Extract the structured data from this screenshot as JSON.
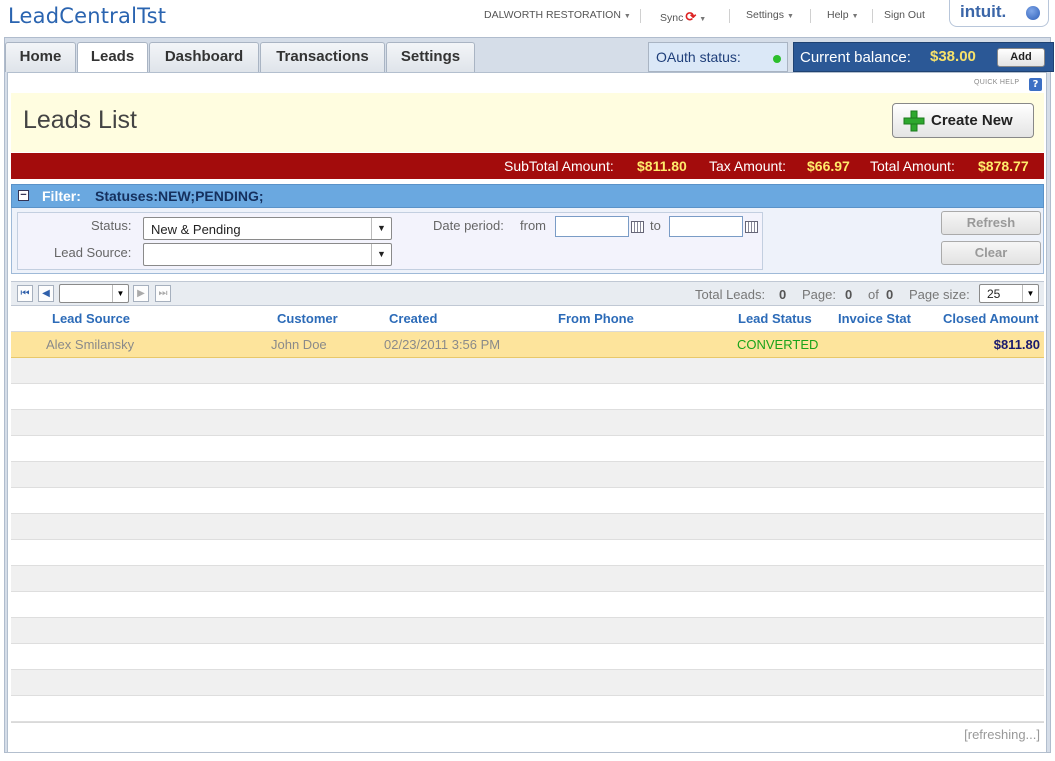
{
  "app": {
    "title": "LeadCentralTst"
  },
  "topnav": {
    "company": "DALWORTH RESTORATION",
    "sync": "Sync",
    "settings": "Settings",
    "help": "Help",
    "signout": "Sign Out",
    "logo_text": "intuit."
  },
  "tabs": [
    {
      "label": "Home"
    },
    {
      "label": "Leads",
      "active": true
    },
    {
      "label": "Dashboard"
    },
    {
      "label": "Transactions"
    },
    {
      "label": "Settings"
    }
  ],
  "oauth": {
    "label": "OAuth status:",
    "status_color": "#2cbf2c"
  },
  "balance": {
    "label": "Current balance:",
    "value": "$38.00",
    "add_label": "Add"
  },
  "quick_help": {
    "label": "QUICK HELP",
    "icon": "?"
  },
  "page": {
    "title": "Leads List",
    "create_new_label": "Create New"
  },
  "totals": {
    "subtotal_label": "SubTotal Amount:",
    "subtotal_value": "$811.80",
    "tax_label": "Tax Amount:",
    "tax_value": "$66.97",
    "total_label": "Total Amount:",
    "total_value": "$878.77"
  },
  "filter": {
    "header_label": "Filter:",
    "header_value": "Statuses:NEW;PENDING;",
    "status_label": "Status:",
    "status_value": "New & Pending",
    "lead_source_label": "Lead Source:",
    "lead_source_value": "",
    "date_period_label": "Date period:",
    "from_label": "from",
    "to_label": "to",
    "from_value": "",
    "to_value": "",
    "refresh_label": "Refresh",
    "clear_label": "Clear"
  },
  "pager": {
    "total_leads_label": "Total Leads:",
    "total_leads": "0",
    "page_label": "Page:",
    "page": "0",
    "of_label": "of",
    "of_value": "0",
    "page_size_label": "Page size:",
    "page_size": "25"
  },
  "grid": {
    "columns": [
      "Lead Source",
      "Customer",
      "Created",
      "From Phone",
      "Lead Status",
      "Invoice Stat",
      "Closed Amount"
    ],
    "rows": [
      {
        "lead_source": "Alex Smilansky",
        "customer": "John Doe",
        "created": "02/23/2011 3:56 PM",
        "from_phone": "",
        "lead_status": "CONVERTED",
        "invoice_status": "",
        "closed_amount": "$811.80"
      }
    ],
    "footer_status": "[refreshing...]"
  },
  "colors": {
    "brand_blue": "#2a64b0",
    "totals_bar": "#a30c0c",
    "highlight_row": "#fde49c",
    "converted": "#1aa31a"
  }
}
